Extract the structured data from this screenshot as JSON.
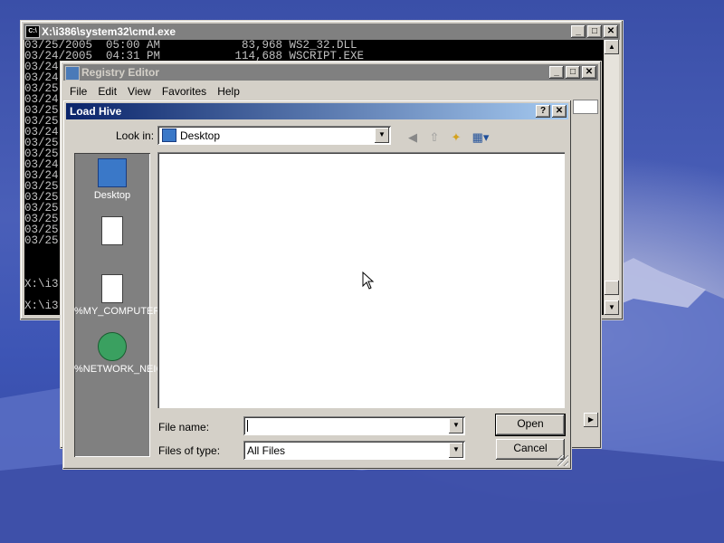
{
  "cmd": {
    "title": "X:\\i386\\system32\\cmd.exe",
    "lines": [
      "03/25/2005  05:00 AM            83,968 WS2_32.DLL",
      "03/24/2005  04:31 PM           114,688 WSCRIPT.EXE",
      "03/24",
      "03/24",
      "03/25",
      "03/24",
      "03/25",
      "03/25",
      "03/24",
      "03/25",
      "03/25",
      "03/24",
      "03/24",
      "03/25",
      "03/25",
      "03/25",
      "03/25",
      "03/25",
      "03/25",
      "",
      "",
      "",
      "X:\\i3",
      "",
      "X:\\i3"
    ]
  },
  "regedit": {
    "title": "Registry Editor",
    "menu": [
      "File",
      "Edit",
      "View",
      "Favorites",
      "Help"
    ]
  },
  "dialog": {
    "title": "Load Hive",
    "look_in_label": "Look in:",
    "look_in_value": "Desktop",
    "places": [
      {
        "label": "Desktop",
        "icon": "desktop-icon"
      },
      {
        "label": "",
        "icon": "window-icon"
      },
      {
        "label": "%MY_COMPUTER%",
        "icon": "computer-icon"
      },
      {
        "label": "%NETWORK_NEIGHBORH...",
        "icon": "network-icon"
      }
    ],
    "file_name_label": "File name:",
    "file_name_value": "",
    "files_of_type_label": "Files of type:",
    "files_of_type_value": "All Files",
    "open_label": "Open",
    "cancel_label": "Cancel",
    "help_glyph": "?",
    "close_glyph": "✕"
  }
}
